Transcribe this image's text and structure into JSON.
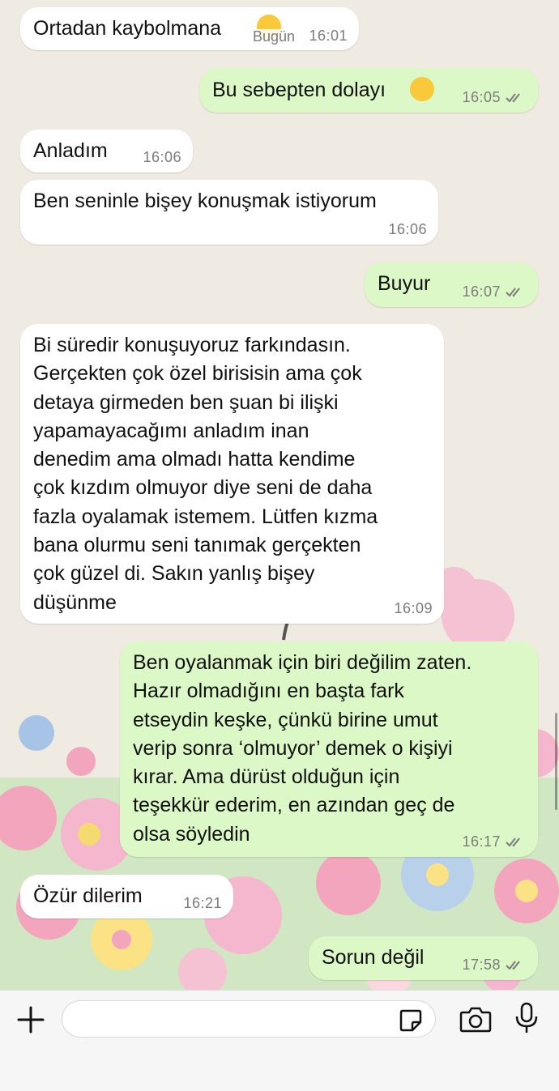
{
  "chat": {
    "day_label": "Bugün",
    "messages": [
      {
        "dir": "in",
        "text": "Ortadan kaybolmana",
        "time": "16:01"
      },
      {
        "dir": "out",
        "text": "Bu sebepten dolayı",
        "time": "16:05"
      },
      {
        "dir": "in",
        "text": "Anladım",
        "time": "16:06"
      },
      {
        "dir": "in",
        "text": "Ben seninle bişey konuşmak istiyorum",
        "time": "16:06"
      },
      {
        "dir": "out",
        "text": "Buyur",
        "time": "16:07"
      },
      {
        "dir": "in",
        "text": "Bi süredir konuşuyoruz farkındasın.\nGerçekten çok özel birisisin ama çok\ndetaya girmeden ben şuan bi ilişki\nyapamayacağımı anladım inan\ndenedim ama olmadı hatta kendime\nçok kızdım olmuyor diye seni de daha\nfazla oyalamak istemem. Lütfen kızma\nbana olurmu seni tanımak gerçekten\nçok güzel di. Sakın yanlış bişey\ndüşünme",
        "time": "16:09"
      },
      {
        "dir": "out",
        "text": "Ben oyalanmak için biri değilim zaten.\nHazır olmadığını en başta fark\netseydin keşke, çünkü birine umut\nverip sonra ‘olmuyor’ demek o kişiyi\nkırar. Ama dürüst olduğun için\nteşekkür ederim, en azından geç de\nolsa söyledin",
        "time": "16:17"
      },
      {
        "dir": "in",
        "text": "Özür dilerim",
        "time": "16:21"
      },
      {
        "dir": "out",
        "text": "Sorun değil",
        "time": "17:58"
      }
    ]
  },
  "composer": {
    "input_value": "",
    "icons": [
      "plus-icon",
      "sticker-icon",
      "camera-icon",
      "microphone-icon"
    ]
  },
  "colors": {
    "incoming_bubble": "#ffffff",
    "outgoing_bubble": "#dcf8c6",
    "ticks": "#7b7b7b",
    "wallpaper": "#efeae2"
  }
}
